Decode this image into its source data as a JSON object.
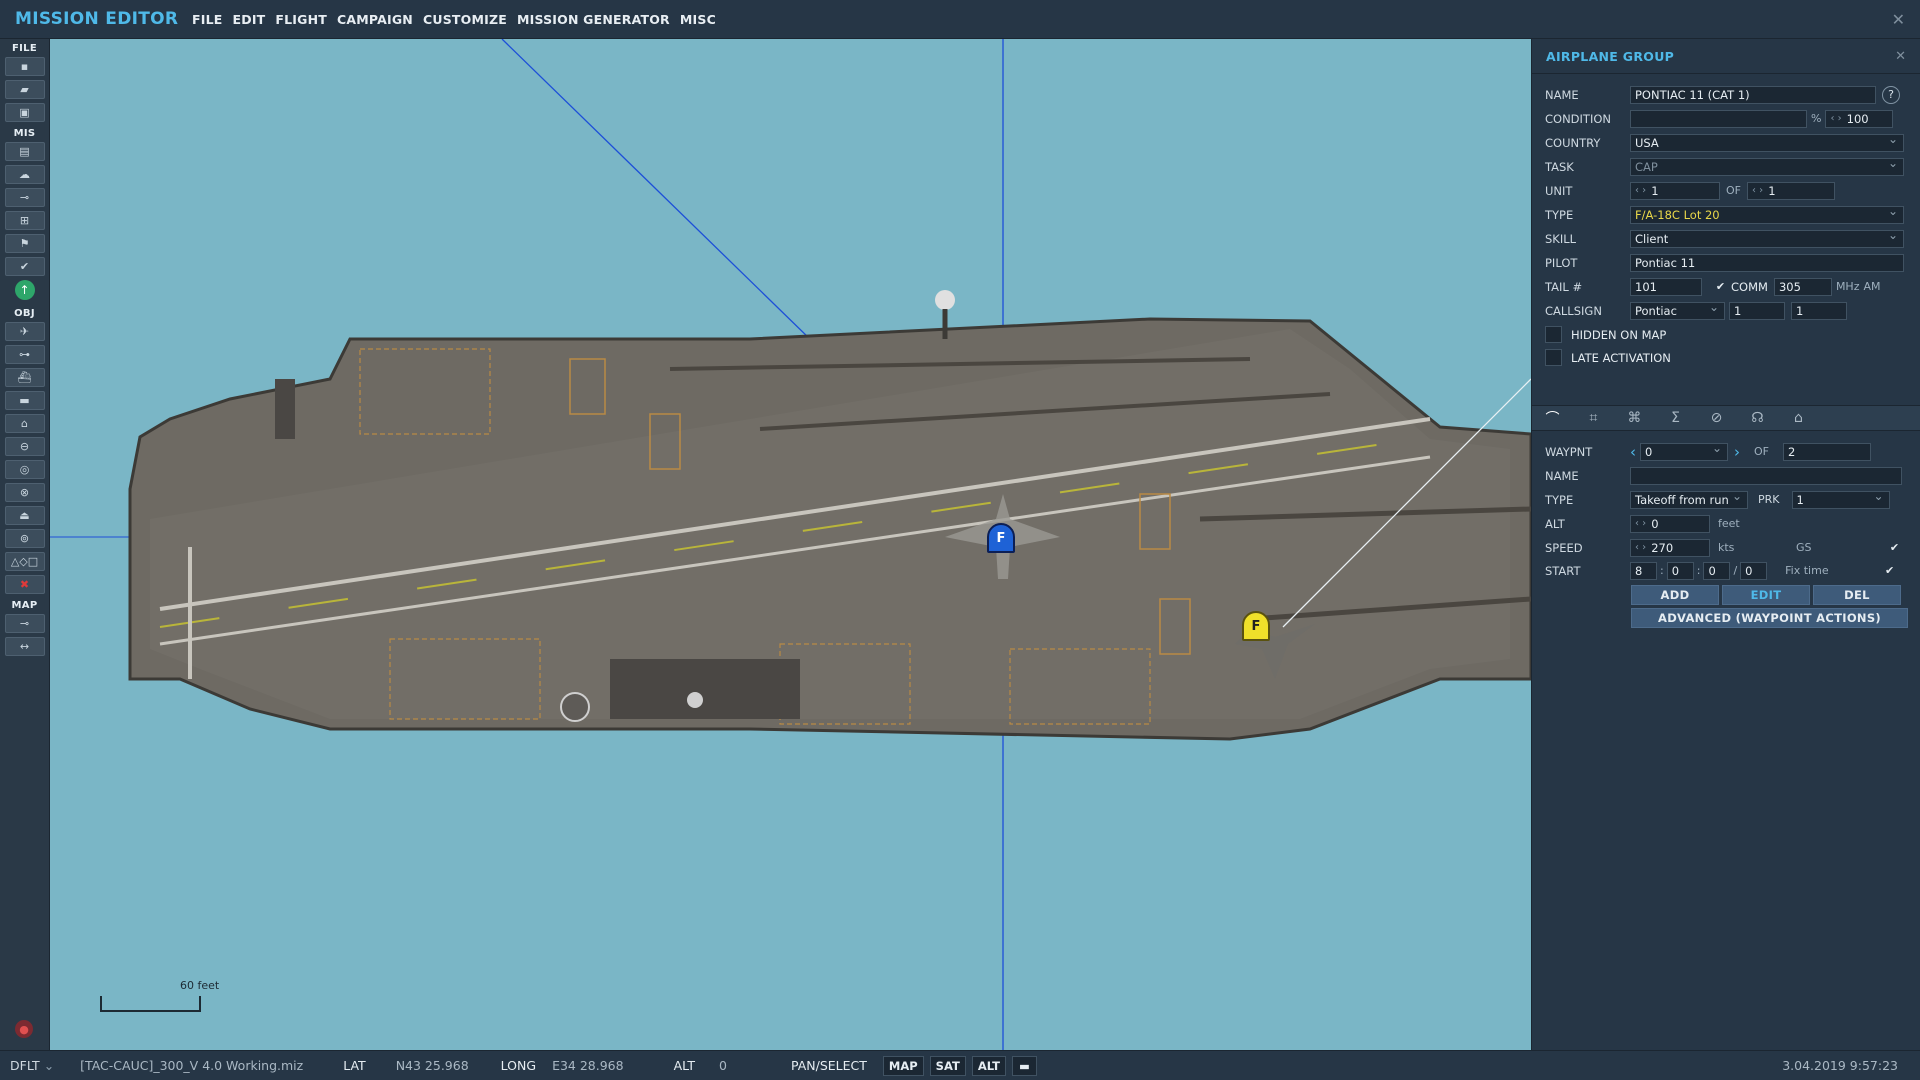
{
  "app": {
    "title": "MISSION EDITOR",
    "close": "✕"
  },
  "menu": [
    "FILE",
    "EDIT",
    "FLIGHT",
    "CAMPAIGN",
    "CUSTOMIZE",
    "MISSION GENERATOR",
    "MISC"
  ],
  "toolbar": {
    "sections": {
      "file": "FILE",
      "mis": "MIS",
      "obj": "OBJ",
      "map": "MAP"
    }
  },
  "map": {
    "scale_label": "60 feet",
    "markers": [
      {
        "letter": "F",
        "color": "#1e62d6"
      },
      {
        "letter": "F",
        "color": "#f0e02a"
      }
    ],
    "colors": {
      "water": "#7ab6c6",
      "deck": "#6e6a63",
      "route": "#1d4fd8"
    }
  },
  "panel": {
    "title": "AIRPLANE GROUP",
    "close": "✕",
    "name": {
      "label": "NAME",
      "value": "PONTIAC 11 (CAT 1)",
      "help": "?"
    },
    "condition": {
      "label": "CONDITION",
      "value": "",
      "pct": "%",
      "amount": "100"
    },
    "country": {
      "label": "COUNTRY",
      "value": "USA"
    },
    "task": {
      "label": "TASK",
      "value": "CAP"
    },
    "unit": {
      "label": "UNIT",
      "value": "1",
      "of_label": "OF",
      "of_value": "1"
    },
    "type": {
      "label": "TYPE",
      "value": "F/A-18C Lot 20"
    },
    "skill": {
      "label": "SKILL",
      "value": "Client"
    },
    "pilot": {
      "label": "PILOT",
      "value": "Pontiac 11"
    },
    "tail": {
      "label": "TAIL #",
      "value": "101",
      "comm_label": "COMM",
      "comm_value": "305",
      "mhz": "MHz",
      "am": "AM"
    },
    "callsign": {
      "label": "CALLSIGN",
      "value": "Pontiac",
      "num1": "1",
      "num2": "1"
    },
    "hidden": {
      "label": "HIDDEN ON MAP"
    },
    "late": {
      "label": "LATE ACTIVATION"
    },
    "waypoint": {
      "label": "WAYPNT",
      "value": "0",
      "of_label": "OF",
      "of_value": "2",
      "name_label": "NAME",
      "name_value": "",
      "type_label": "TYPE",
      "type_value": "Takeoff from run",
      "prk_label": "PRK",
      "prk_value": "1",
      "alt_label": "ALT",
      "alt_value": "0",
      "alt_unit": "feet",
      "speed_label": "SPEED",
      "speed_value": "270",
      "speed_unit": "kts",
      "gs_label": "GS",
      "start_label": "START",
      "start_h": "8",
      "start_m": "0",
      "start_s": "0",
      "start_d": "0",
      "fix_time_label": "Fix time",
      "add": "ADD",
      "edit": "EDIT",
      "del": "DEL",
      "advanced": "ADVANCED (WAYPOINT ACTIONS)"
    }
  },
  "status": {
    "mode": "DFLT",
    "file": "[TAC-CAUC]_300_V 4.0 Working.miz",
    "lat_label": "LAT",
    "lat_value": "N43 25.968",
    "long_label": "LONG",
    "long_value": "E34 28.968",
    "alt_label": "ALT",
    "alt_value": "0",
    "pan": "PAN/SELECT",
    "map_btn": "MAP",
    "sat_btn": "SAT",
    "alt_btn": "ALT",
    "datetime": "3.04.2019 9:57:23"
  }
}
